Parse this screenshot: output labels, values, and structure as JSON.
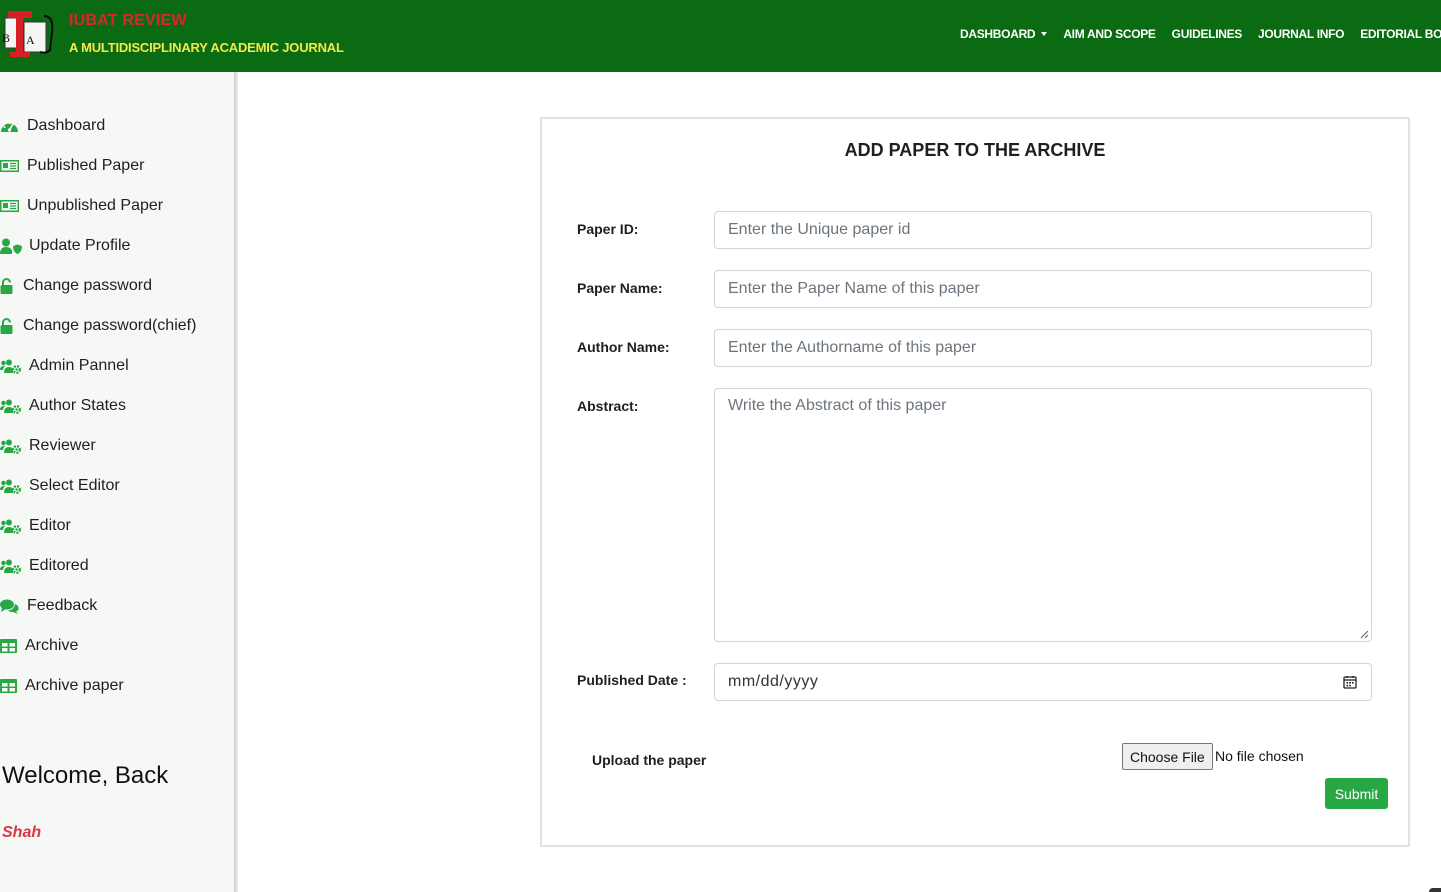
{
  "header": {
    "brand_title": "IUBAT REVIEW",
    "brand_subtitle": "A MULTIDISCIPLINARY ACADEMIC JOURNAL",
    "nav": [
      "DASHBOARD",
      "AIM AND SCOPE",
      "GUIDELINES",
      "JOURNAL INFO",
      "EDITORIAL BOARD"
    ],
    "colors": {
      "bar": "#0a6b12",
      "title": "#e0232b",
      "subtitle": "#f3e84a"
    }
  },
  "sidebar": {
    "items": [
      {
        "label": "Dashboard",
        "icon": "gauge-icon"
      },
      {
        "label": "Published Paper",
        "icon": "newspaper-icon"
      },
      {
        "label": "Unpublished Paper",
        "icon": "newspaper-icon"
      },
      {
        "label": "Update Profile",
        "icon": "user-shield-icon"
      },
      {
        "label": "Change password",
        "icon": "unlock-icon"
      },
      {
        "label": "Change password(chief)",
        "icon": "unlock-icon"
      },
      {
        "label": "Admin Pannel",
        "icon": "users-cog-icon"
      },
      {
        "label": "Author States",
        "icon": "users-cog-icon"
      },
      {
        "label": "Reviewer",
        "icon": "users-cog-icon"
      },
      {
        "label": "Select Editor",
        "icon": "users-cog-icon"
      },
      {
        "label": "Editor",
        "icon": "users-cog-icon"
      },
      {
        "label": "Editored",
        "icon": "users-cog-icon"
      },
      {
        "label": "Feedback",
        "icon": "comments-icon"
      },
      {
        "label": "Archive",
        "icon": "table-icon"
      },
      {
        "label": "Archive paper",
        "icon": "table-icon"
      }
    ],
    "welcome": "Welcome, Back",
    "username": "Shah",
    "icon_color": "#28a745"
  },
  "form": {
    "title": "ADD PAPER TO THE ARCHIVE",
    "paper_id_label": "Paper ID:",
    "paper_id_placeholder": "Enter the Unique paper id",
    "paper_name_label": "Paper Name:",
    "paper_name_placeholder": "Enter the Paper Name of this paper",
    "author_label": "Author Name:",
    "author_placeholder": "Enter the Authorname of this paper",
    "abstract_label": "Abstract:",
    "abstract_placeholder": "Write the Abstract of this paper",
    "date_label": "Published Date :",
    "date_placeholder": "mm/dd/yyyy",
    "upload_label": "Upload the paper",
    "choose_file": "Choose File",
    "file_status": "No file chosen",
    "submit": "Submit",
    "submit_color": "#28a745"
  }
}
